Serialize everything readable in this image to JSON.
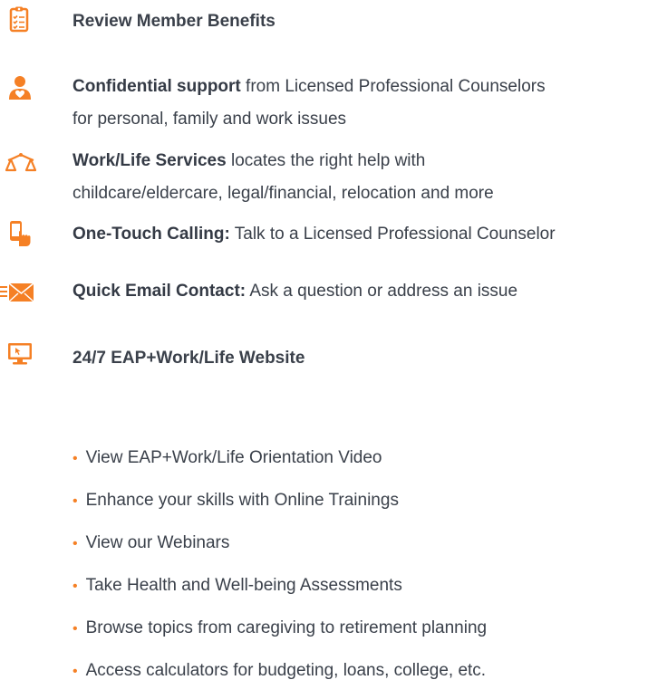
{
  "colors": {
    "accent": "#f58025",
    "text": "#3a404a"
  },
  "header": {
    "title": "Review Member Benefits",
    "icon": "clipboard-checklist-icon"
  },
  "benefits": [
    {
      "icon": "person-counselor-icon",
      "bold": "Confidential support",
      "line1_rest": " from Licensed Professional Counselors",
      "line2": "for personal, family and work issues"
    },
    {
      "icon": "scales-icon",
      "bold": "Work/Life Services",
      "line1_rest": " locates the right help with",
      "line2": "childcare/eldercare, legal/financial, relocation and more"
    },
    {
      "icon": "phone-tap-icon",
      "bold": "One-Touch Calling:",
      "line1_rest": " Talk to a Licensed Professional Counselor"
    },
    {
      "icon": "email-send-icon",
      "bold": "Quick Email Contact:",
      "line1_rest": " Ask a question or address an issue"
    }
  ],
  "website": {
    "icon": "monitor-cursor-icon",
    "title": "24/7 EAP+Work/Life Website",
    "bullet_char": "•",
    "items": [
      "View EAP+Work/Life Orientation Video",
      "Enhance your skills with Online Trainings",
      "View our Webinars",
      "Take Health and Well-being Assessments",
      "Browse topics from caregiving to retirement planning",
      "Access calculators for budgeting, loans, college, etc."
    ]
  }
}
